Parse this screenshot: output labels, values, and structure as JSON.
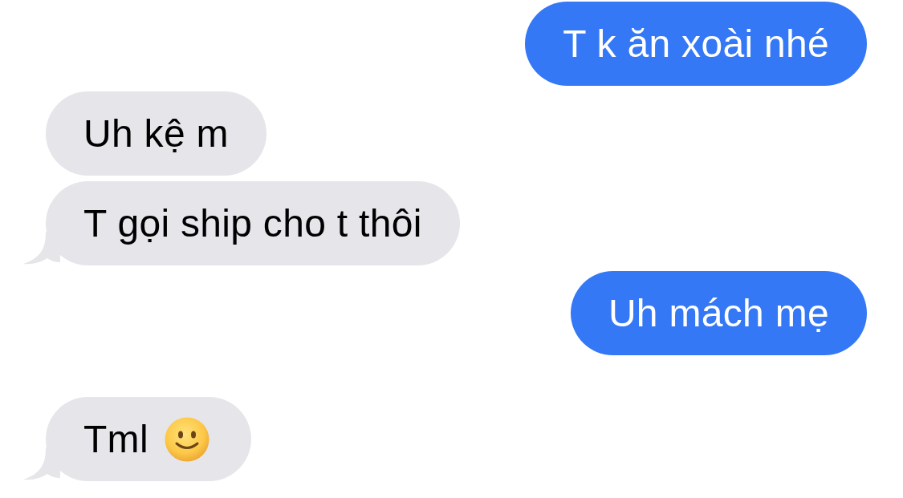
{
  "messages": [
    {
      "kind": "sent",
      "text": "T k ăn xoài nhé",
      "tail": false,
      "emoji": false
    },
    {
      "kind": "received",
      "text": "Uh kệ m",
      "tail": false,
      "emoji": false
    },
    {
      "kind": "received",
      "text": "T gọi ship cho t thôi",
      "tail": true,
      "emoji": false
    },
    {
      "kind": "sent",
      "text": "Uh mách mẹ",
      "tail": false,
      "emoji": false
    },
    {
      "kind": "received",
      "text": "Tml",
      "tail": true,
      "emoji": true
    }
  ]
}
